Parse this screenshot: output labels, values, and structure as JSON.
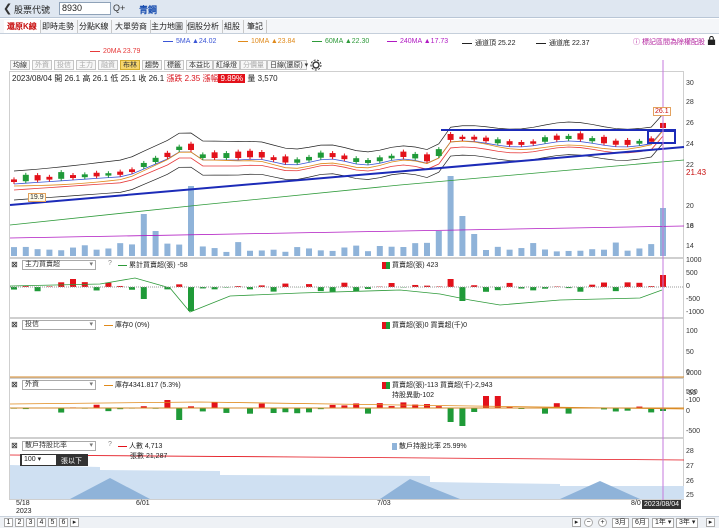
{
  "header": {
    "back_icon": "chevron-left-icon",
    "title": "股票代號",
    "code": "8930",
    "search": "Q+",
    "stock_name": "青鋼"
  },
  "tabs": [
    "還原K線",
    "即時走勢",
    "分點K線",
    "大單勞商",
    "主力地圖",
    "個股分析",
    "組股",
    "筆記"
  ],
  "ma_row1": [
    {
      "label": "5MA",
      "value": "▲24.02",
      "color": "#3a55d6"
    },
    {
      "label": "10MA",
      "value": "▲23.84",
      "color": "#e08a1b"
    },
    {
      "label": "60MA",
      "value": "▲22.30",
      "color": "#2e9a3a"
    },
    {
      "label": "240MA",
      "value": "▲17.73",
      "color": "#b019c2"
    },
    {
      "label": "通道頂",
      "value": "25.22",
      "color": "#222"
    },
    {
      "label": "通道底",
      "value": "22.37",
      "color": "#222"
    }
  ],
  "ma_row2": {
    "label": "20MA",
    "value": "23.79",
    "color": "#e63a3a"
  },
  "notice": "標記區間為除權配股",
  "toolbar": [
    "均線",
    "外資",
    "投信",
    "主力",
    "融資",
    "布林",
    "趨勢",
    "標籤",
    "本益比",
    "紅綠燈",
    "分價量",
    "日線(還原)"
  ],
  "ohlc": {
    "date": "2023/08/04",
    "open": "開 26.1",
    "high": "高 26.1",
    "low": "低 25.1",
    "close": "收 26.1",
    "change": "漲跌 2.35",
    "pct_label": "漲幅",
    "pct": "9.89%",
    "vol": "量 3,570"
  },
  "price_axis": [
    "30",
    "28",
    "26",
    "24",
    "22",
    "20",
    "18",
    "16",
    "14"
  ],
  "price_callouts": {
    "high": "26.1",
    "current": "21.43",
    "low": "19.9"
  },
  "panel_main_force": {
    "select": "主力買賣超",
    "legend1": "累計買賣超(張) -58",
    "legend2": "買賣超(張) 423",
    "axis": [
      "1000",
      "500",
      "0",
      "-500",
      "-1000"
    ]
  },
  "panel_trust": {
    "select": "投信",
    "legend1": "庫存0 (0%)",
    "legend2": "買賣超(張)0 買賣超(千)0",
    "axis": [
      "100",
      "50",
      "0",
      "-50",
      "-100"
    ]
  },
  "panel_foreign": {
    "select": "外資",
    "legend1": "庫存4341.817 (5.3%)",
    "legend2": "買賣超(張)-113 買賣超(千)-2,943",
    "legend3": "持股異動-102",
    "axis": [
      "1000",
      "500",
      "0",
      "-500"
    ]
  },
  "panel_holders": {
    "select": "散戶持股比率",
    "legend1": "人數 4,713",
    "legend2": "張數 21,287",
    "legend3": "散戶持股比率 25.99%",
    "filter_value": "100",
    "filter_label": "張以下",
    "axis": [
      "28",
      "27",
      "26",
      "25"
    ]
  },
  "xaxis": {
    "d1": "5/18",
    "year": "2023",
    "d2": "6/01",
    "d3": "7/03",
    "d4": "8/0",
    "tip": "2023/08/04"
  },
  "pages": [
    "1",
    "2",
    "3",
    "4",
    "5",
    "6"
  ],
  "range_buttons": [
    "3月",
    "6月",
    "1年",
    "3年"
  ],
  "colors": {
    "up": "#e3111a",
    "down": "#1f9a38",
    "volume": "#8fb3d9",
    "channel": "#1c2bb8"
  }
}
